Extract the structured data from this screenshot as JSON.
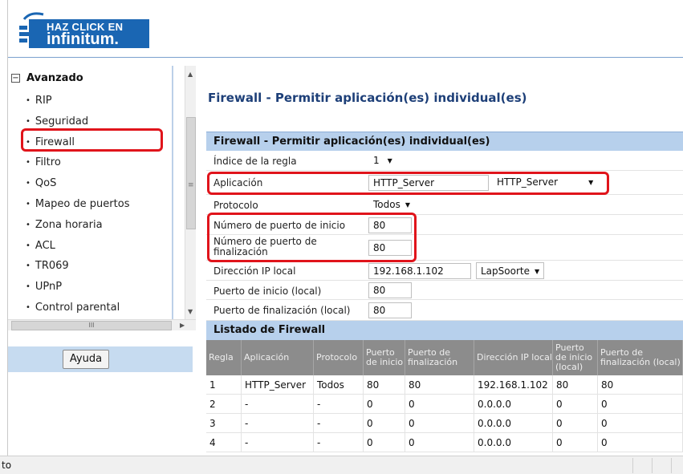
{
  "logo": {
    "line1": "HAZ CLICK EN",
    "line2": "infinitum."
  },
  "sidebar": {
    "section": "Avanzado",
    "items": [
      "RIP",
      "Seguridad",
      "Firewall",
      "Filtro",
      "QoS",
      "Mapeo de puertos",
      "Zona horaria",
      "ACL",
      "TR069",
      "UPnP",
      "Control parental"
    ],
    "active": "Firewall",
    "scroll_grip": "≡",
    "hscroll_grip": "III"
  },
  "help_button": "Ayuda",
  "page_title": "Firewall - Permitir aplicación(es) individual(es)",
  "form": {
    "header": "Firewall - Permitir aplicación(es) individual(es)",
    "fields": {
      "rule_index": {
        "label": "Índice de la regla",
        "value": "1"
      },
      "application": {
        "label": "Aplicación",
        "value": "HTTP_Server",
        "select": "HTTP_Server"
      },
      "protocol": {
        "label": "Protocolo",
        "value": "Todos"
      },
      "start_port": {
        "label": "Número de puerto de inicio",
        "value": "80"
      },
      "end_port": {
        "label": "Número de puerto de finalización",
        "value": "80"
      },
      "local_ip": {
        "label": "Dirección IP local",
        "value": "192.168.1.102",
        "select": "LapSoorte"
      },
      "local_start_port": {
        "label": "Puerto de inicio (local)",
        "value": "80"
      },
      "local_end_port": {
        "label": "Puerto de finalización (local)",
        "value": "80"
      }
    }
  },
  "list": {
    "header": "Listado de Firewall",
    "columns": [
      "Regla",
      "Aplicación",
      "Protocolo",
      "Puerto de inicio",
      "Puerto de finalización",
      "Dirección IP local",
      "Puerto de inicio (local)",
      "Puerto de finalización (local)"
    ],
    "rows": [
      [
        "1",
        "HTTP_Server",
        "Todos",
        "80",
        "80",
        "192.168.1.102",
        "80",
        "80"
      ],
      [
        "2",
        "-",
        "-",
        "0",
        "0",
        "0.0.0.0",
        "0",
        "0"
      ],
      [
        "3",
        "-",
        "-",
        "0",
        "0",
        "0.0.0.0",
        "0",
        "0"
      ],
      [
        "4",
        "-",
        "-",
        "0",
        "0",
        "0.0.0.0",
        "0",
        "0"
      ]
    ]
  },
  "status_bar": "to",
  "colors": {
    "highlight": "#e0141b",
    "panel_header": "#b7d0ec",
    "table_header": "#8c8c8c",
    "title": "#1d3f78"
  }
}
